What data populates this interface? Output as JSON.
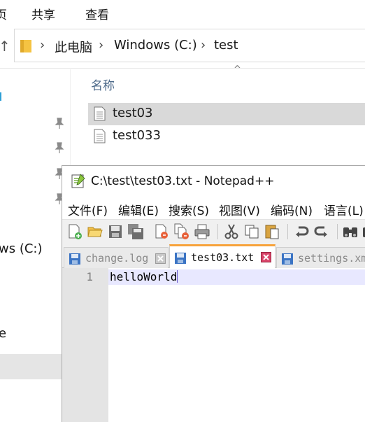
{
  "explorer": {
    "ribbon_tabs": [
      "页",
      "共享",
      "查看"
    ],
    "breadcrumb": [
      "此电脑",
      "Windows (C:)",
      "test"
    ],
    "nav_labels": [
      "ws (C:)",
      "e"
    ],
    "column_header": "名称",
    "files": [
      {
        "name": "test03",
        "selected": true
      },
      {
        "name": "test033",
        "selected": false
      }
    ]
  },
  "notepad": {
    "title": "C:\\test\\test03.txt - Notepad++",
    "menu": [
      "文件(F)",
      "编辑(E)",
      "搜索(S)",
      "视图(V)",
      "编码(N)",
      "语言(L)"
    ],
    "tabs": [
      {
        "label": "change.log",
        "active": false
      },
      {
        "label": "test03.txt",
        "active": true
      },
      {
        "label": "settings.xml",
        "active": false
      }
    ],
    "line_number": "1",
    "content": "helloWorld"
  },
  "colors": {
    "tab_accent": "#f7a23a",
    "current_line": "#e8e8ff",
    "selection": "#d9d9d9"
  }
}
